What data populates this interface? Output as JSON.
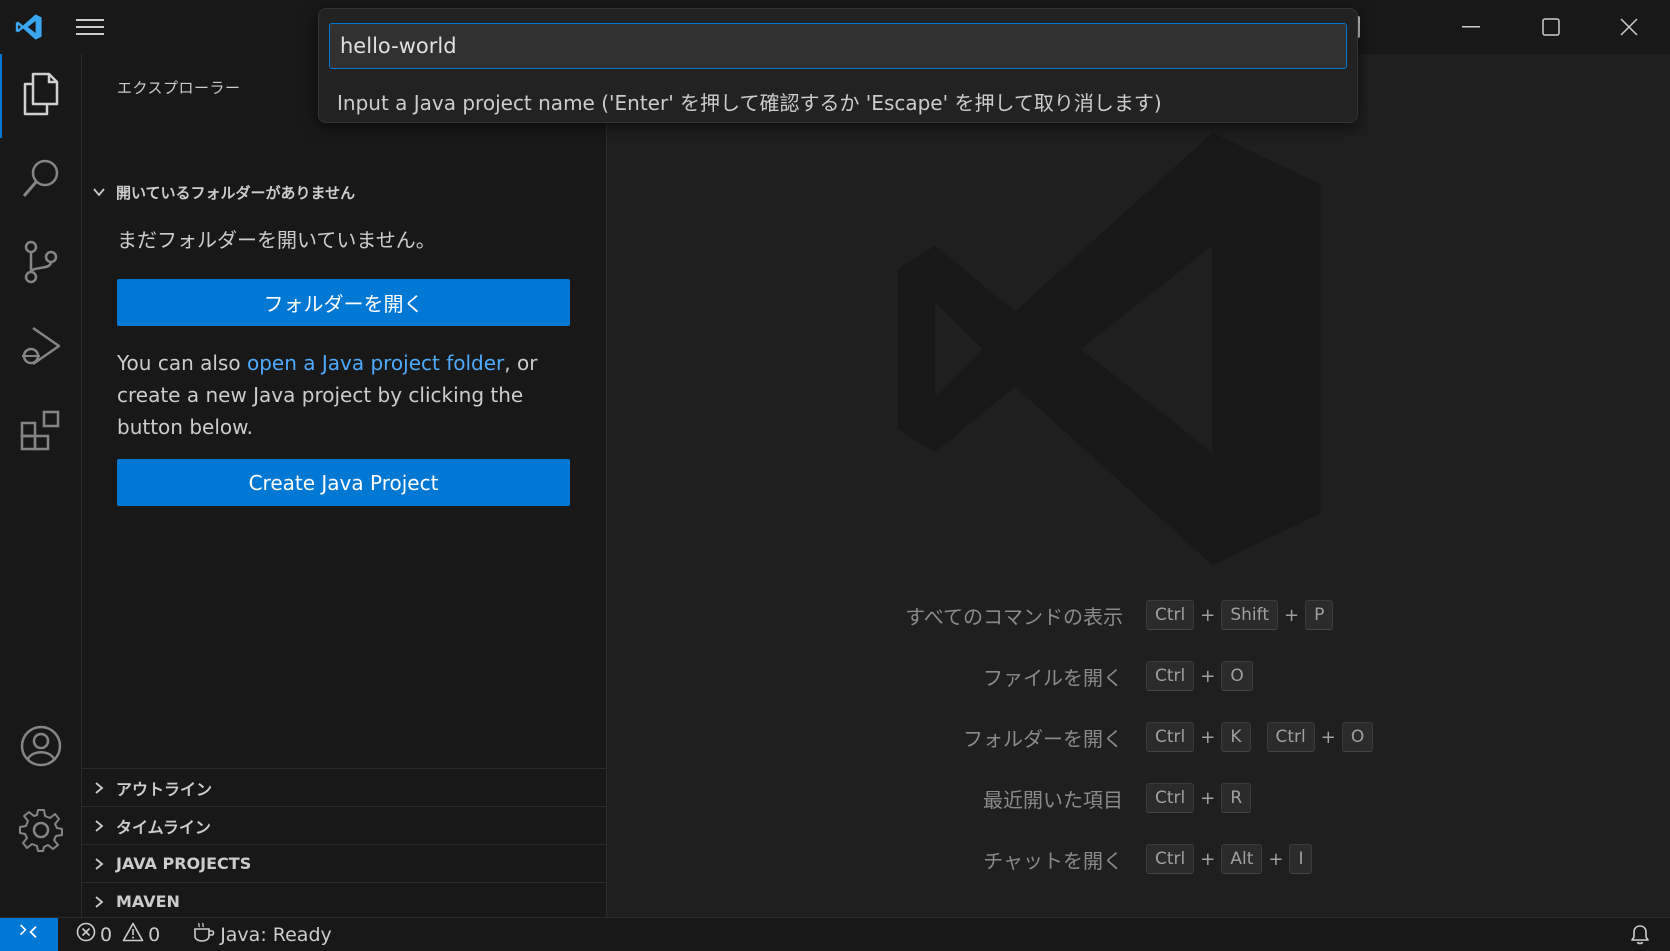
{
  "window": {
    "title": "Visual Studio Code"
  },
  "titlebar": {
    "controls": {
      "minimize": "—",
      "maximize": "☐",
      "close": "✕"
    }
  },
  "quick_input": {
    "value": "hello-world",
    "message": "Input a Java project name ('Enter' を押して確認するか 'Escape' を押して取り消します)"
  },
  "activity_bar": {
    "items": [
      {
        "name": "explorer",
        "icon": "files-icon"
      },
      {
        "name": "search",
        "icon": "search-icon"
      },
      {
        "name": "source-control",
        "icon": "source-control-icon"
      },
      {
        "name": "run-debug",
        "icon": "run-debug-icon"
      },
      {
        "name": "extensions",
        "icon": "extensions-icon"
      }
    ],
    "bottom": [
      {
        "name": "accounts",
        "icon": "account-icon"
      },
      {
        "name": "manage",
        "icon": "gear-icon"
      }
    ]
  },
  "sidebar": {
    "title": "エクスプローラー",
    "section_header": "開いているフォルダーがありません",
    "no_folder_text": "まだフォルダーを開いていません。",
    "open_folder_button": "フォルダーを開く",
    "java_text_prefix": "You can also ",
    "java_text_link": "open a Java project folder",
    "java_text_suffix_line1": ", or",
    "java_text_line2": "create a new Java project by clicking the",
    "java_text_line3": "button below.",
    "create_java_button": "Create Java Project",
    "sections": [
      {
        "label": "アウトライン"
      },
      {
        "label": "タイムライン"
      },
      {
        "label": "JAVA PROJECTS"
      },
      {
        "label": "MAVEN"
      }
    ]
  },
  "editor": {
    "shortcuts": [
      {
        "label": "すべてのコマンドの表示",
        "keys": [
          "Ctrl",
          "Shift",
          "P"
        ]
      },
      {
        "label": "ファイルを開く",
        "keys": [
          "Ctrl",
          "O"
        ]
      },
      {
        "label": "フォルダーを開く",
        "keys": [
          "Ctrl",
          "K"
        ],
        "keys2": [
          "Ctrl",
          "O"
        ]
      },
      {
        "label": "最近開いた項目",
        "keys": [
          "Ctrl",
          "R"
        ]
      },
      {
        "label": "チャットを開く",
        "keys": [
          "Ctrl",
          "Alt",
          "I"
        ]
      }
    ]
  },
  "statusbar": {
    "errors": "0",
    "warnings": "0",
    "java_status": "Java: Ready"
  },
  "colors": {
    "accent": "#0078d4",
    "link": "#4daafc",
    "background": "#1f1f1f",
    "sidebar": "#181818"
  }
}
